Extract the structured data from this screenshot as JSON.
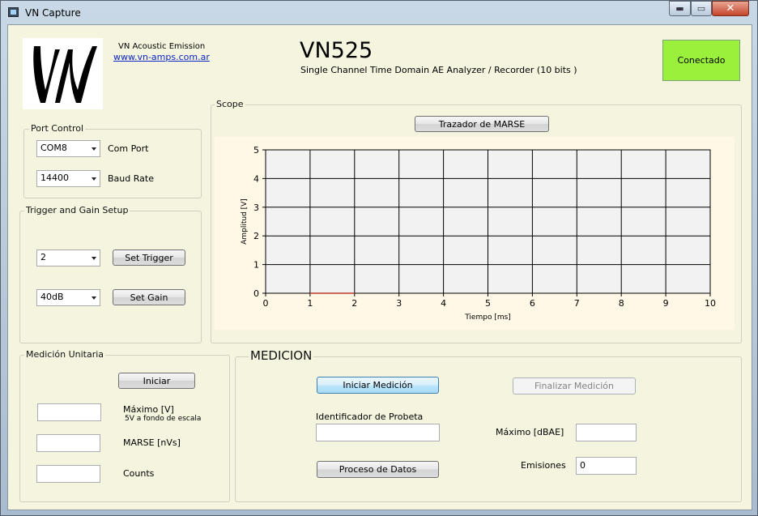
{
  "window": {
    "title": "VN Capture",
    "min_glyph": "▬",
    "max_glyph": "▭",
    "close_glyph": "✕"
  },
  "header": {
    "company": "VN Acoustic Emission",
    "website": "www.vn-amps.com.ar",
    "product": "VN525",
    "subtitle": "Single Channel Time Domain AE Analyzer / Recorder (10 bits )",
    "status": "Conectado",
    "status_color": "#9bf03b"
  },
  "port_control": {
    "title": "Port Control",
    "port_value": "COM8",
    "port_label": "Com Port",
    "baud_value": "14400",
    "baud_label": "Baud Rate"
  },
  "trigger": {
    "title": "Trigger and  Gain Setup",
    "trigger_value": "2",
    "set_trigger": "Set Trigger",
    "gain_value": "40dB",
    "set_gain": "Set Gain"
  },
  "scope": {
    "title": "Scope",
    "marse_button": "Trazador de MARSE",
    "chart_data": {
      "type": "line",
      "xlabel": "Tiempo [ms]",
      "ylabel": "Amplitud [V]",
      "xlim": [
        0,
        10
      ],
      "ylim": [
        0,
        5
      ],
      "x_ticks": [
        "0",
        "1",
        "2",
        "3",
        "4",
        "5",
        "6",
        "7",
        "8",
        "9",
        "10"
      ],
      "y_ticks": [
        "0",
        "1",
        "2",
        "3",
        "4",
        "5"
      ],
      "grid": true,
      "plot_bg": "#f2f2f2",
      "series": [
        {
          "color": "#c0392b",
          "x": [
            1.0,
            2.0
          ],
          "y": [
            0.0,
            0.0
          ]
        }
      ]
    }
  },
  "unitaria": {
    "title": "Medición Unitaria",
    "iniciar": "Iniciar",
    "maximo_label": "Máximo [V]",
    "maximo_hint": "5V a fondo de escala",
    "marse_label": "MARSE [nVs]",
    "counts_label": "Counts"
  },
  "medicion": {
    "title": "MEDICION",
    "iniciar": "Iniciar Medición",
    "finalizar": "Finalizar Medición",
    "identificador_label": "Identificador de Probeta",
    "maximo_label": "Máximo [dBAE]",
    "proceso": "Proceso de Datos",
    "emisiones_label": "Emisiones",
    "emisiones_value": "0"
  }
}
